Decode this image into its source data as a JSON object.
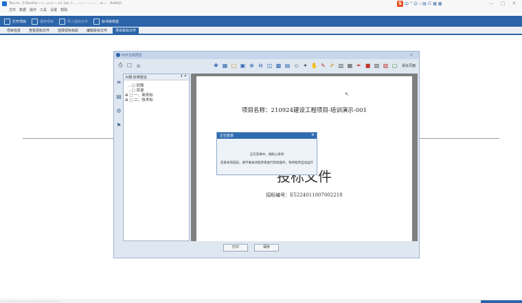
{
  "window": {
    "title": "Teo:m...3:6eoOa—: l...u.n—..n1 (oo..f ... —:— —.—· .. e—: ..8a8o[f..",
    "ime_icons": [
      "S",
      "中",
      "°",
      "☺",
      "♩",
      "▤",
      "☷",
      "▦",
      "▩"
    ],
    "controls": [
      "—",
      "□",
      "✕"
    ]
  },
  "menu": [
    "文件",
    "数据",
    "操作",
    "工具",
    "设置",
    "帮助"
  ],
  "toolbar": [
    {
      "label": "打开项目",
      "enabled": true
    },
    {
      "label": "保存项目",
      "enabled": false
    },
    {
      "label": "导入招标文件",
      "enabled": false
    },
    {
      "label": "标书库校验",
      "enabled": true
    }
  ],
  "tabs": [
    {
      "label": "项目信息",
      "active": false
    },
    {
      "label": "查看招标文件",
      "active": false
    },
    {
      "label": "选择招标标段",
      "active": false
    },
    {
      "label": "编辑投标文件",
      "active": false
    },
    {
      "label": "导出投标文件",
      "active": true
    }
  ],
  "viewer": {
    "title": "PDF文档预览",
    "fit_label": "适合页面",
    "tools": [
      "⎙",
      "☐",
      "⌂",
      "✚",
      "▦",
      "□",
      "▣",
      "⊕",
      "⊖",
      "◫",
      "▩",
      "▤",
      "◇",
      "✦",
      "✋",
      "✎",
      "✐",
      "▥",
      "▦",
      "✒",
      "■",
      "▧",
      "▨",
      "▢"
    ],
    "side_icons": [
      "≡",
      "▤",
      "⚙",
      "⚑"
    ],
    "tree_title": "大纲-标准签证",
    "tree_pin": "↕ ✕",
    "tree": [
      "…□ 封面",
      "…□ 目录",
      "⊞ □ 一、商务标",
      "⊞ □ 二、技术标"
    ],
    "document": {
      "project": "项目名称：210924建设工程项目-培训演示-001",
      "big_title": "投标文件",
      "bid_no": "招标编号：E5224011007002218"
    },
    "buttons": {
      "print": "打印",
      "save": "保存"
    }
  },
  "progress": {
    "title": "正在签章",
    "close": "✕",
    "line1": "正在签章中，请耐心等待",
    "line2": "签章未完成前，请不要关闭程序或进行其他操作，等待程序自动运行"
  },
  "status_bar": "… .... …. ... .... … .. ..... ….… ..... …"
}
